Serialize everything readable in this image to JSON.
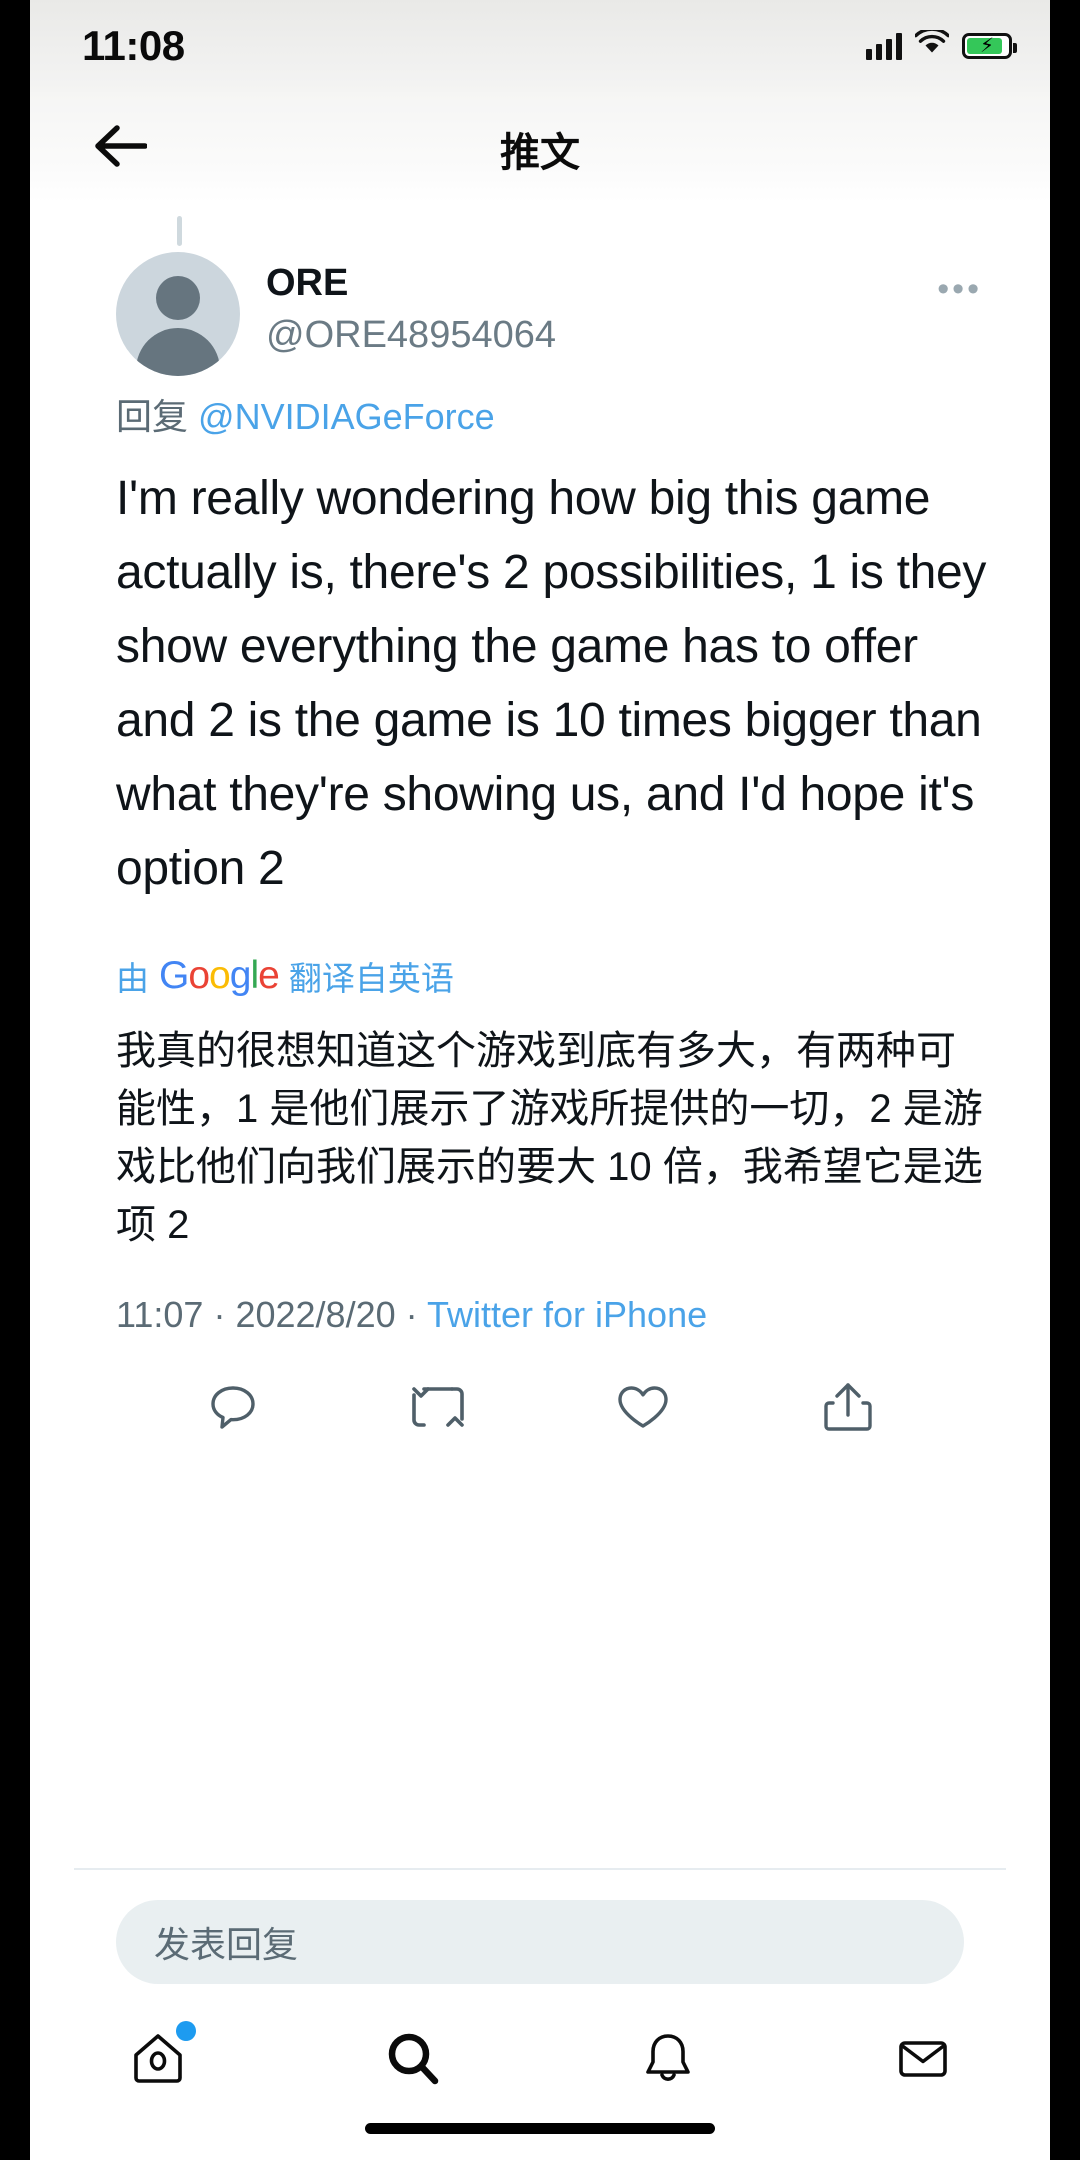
{
  "status_bar": {
    "time": "11:08",
    "icons": [
      "cellular-signal-icon",
      "wifi-icon",
      "battery-charging-icon"
    ]
  },
  "header": {
    "back_icon": "back-arrow-icon",
    "title": "推文",
    "more_icon": "more-options-icon",
    "more_label": "•••"
  },
  "tweet": {
    "author_name": "ORE",
    "author_handle": "@ORE48954064",
    "avatar_icon": "default-avatar-icon",
    "reply_prefix": "回复",
    "reply_mention": "@NVIDIAGeForce",
    "text": "I'm really wondering how big this game actually is, there's 2 possibilities, 1 is they show everything the game has to offer and 2 is the game is 10 times bigger than what they're showing us, and I'd hope it's option 2",
    "translation": {
      "by_label": "由",
      "provider": "Google",
      "provider_letters": [
        "G",
        "o",
        "o",
        "g",
        "l",
        "e"
      ],
      "suffix_label": "翻译自英语",
      "translated_text": "我真的很想知道这个游戏到底有多大，有两种可能性，1 是他们展示了游戏所提供的一切，2 是游戏比他们向我们展示的要大 10 倍，我希望它是选项 2"
    },
    "meta": {
      "time": "11:07",
      "separator": "·",
      "date": "2022/8/20",
      "source": "Twitter for iPhone"
    },
    "actions": [
      {
        "name": "reply-action",
        "icon": "comment-icon"
      },
      {
        "name": "retweet-action",
        "icon": "retweet-icon"
      },
      {
        "name": "like-action",
        "icon": "heart-icon"
      },
      {
        "name": "share-action",
        "icon": "share-icon"
      }
    ]
  },
  "composer": {
    "placeholder": "发表回复"
  },
  "bottom_nav": [
    {
      "name": "nav-home",
      "icon": "home-icon",
      "active": false,
      "badge": true
    },
    {
      "name": "nav-search",
      "icon": "search-icon",
      "active": true,
      "badge": false
    },
    {
      "name": "nav-notifications",
      "icon": "bell-icon",
      "active": false,
      "badge": false
    },
    {
      "name": "nav-messages",
      "icon": "envelope-icon",
      "active": false,
      "badge": false
    }
  ],
  "colors": {
    "link_blue": "#4aa3e8",
    "accent_blue": "#1d9bf0",
    "text_primary": "#0f1419",
    "text_secondary": "#5b6b75",
    "battery_green": "#34c759"
  }
}
